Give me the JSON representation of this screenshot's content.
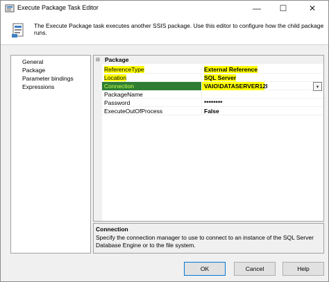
{
  "window": {
    "title": "Execute Package Task Editor",
    "controls": {
      "minimize": "—",
      "maximize": "☐",
      "close": "✕"
    }
  },
  "header": {
    "text": "The Execute Package task executes another SSIS package. Use this editor to configure how the child package runs."
  },
  "nav": {
    "items": [
      {
        "label": "General"
      },
      {
        "label": "Package",
        "selected": true
      },
      {
        "label": "Parameter bindings"
      },
      {
        "label": "Expressions"
      }
    ]
  },
  "grid": {
    "category": {
      "toggle": "⊟",
      "label": "Package"
    },
    "properties": [
      {
        "name": "ReferenceType",
        "value": "External Reference"
      },
      {
        "name": "Location",
        "value": "SQL Server"
      },
      {
        "name": "Connection",
        "value": "VAIO\\DATASERVER12I"
      },
      {
        "name": "PackageName",
        "value": ""
      },
      {
        "name": "Password",
        "value": "********"
      },
      {
        "name": "ExecuteOutOfProcess",
        "value": "False"
      }
    ],
    "dropdown_glyph": "▾"
  },
  "description": {
    "title": "Connection",
    "body": "Specify the connection manager to use to connect to an instance of the SQL Server Database Engine or to the file system."
  },
  "buttons": {
    "ok": "OK",
    "cancel": "Cancel",
    "help": "Help"
  },
  "colors": {
    "highlight": "#ffff00",
    "selected_row": "#2e7d32",
    "selected_text": "#c8ff4d",
    "accent": "#0078d7"
  }
}
